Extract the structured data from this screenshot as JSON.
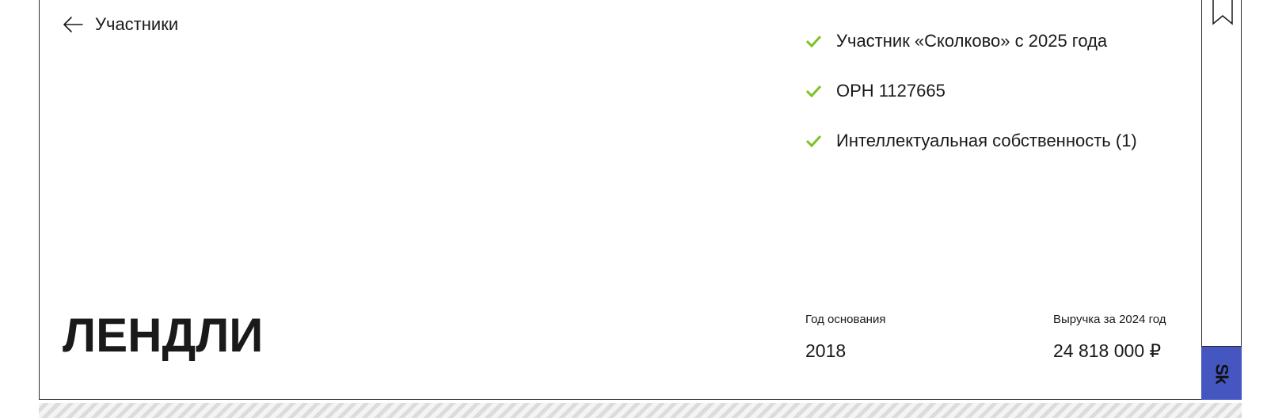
{
  "nav": {
    "back_label": "Участники",
    "back_icon": "arrow-left-icon"
  },
  "features": [
    {
      "icon": "check-icon",
      "text": "Участник «Сколково» с 2025 года"
    },
    {
      "icon": "check-icon",
      "text": "ОРН 1127665"
    },
    {
      "icon": "check-icon",
      "text": "Интеллектуальная собственность (1)"
    }
  ],
  "company": {
    "name": "ЛЕНДЛИ"
  },
  "stats": {
    "founded_label": "Год основания",
    "founded_value": "2018",
    "revenue_label": "Выручка за 2024 год",
    "revenue_value": "24 818 000 ₽"
  },
  "sidebar": {
    "bookmark_icon": "bookmark-icon",
    "logo_text": "Sk"
  },
  "colors": {
    "accent_check": "#7cc222",
    "logo_bg": "#4556c0",
    "text": "#1a1a1a",
    "border": "#2b2b2b"
  }
}
